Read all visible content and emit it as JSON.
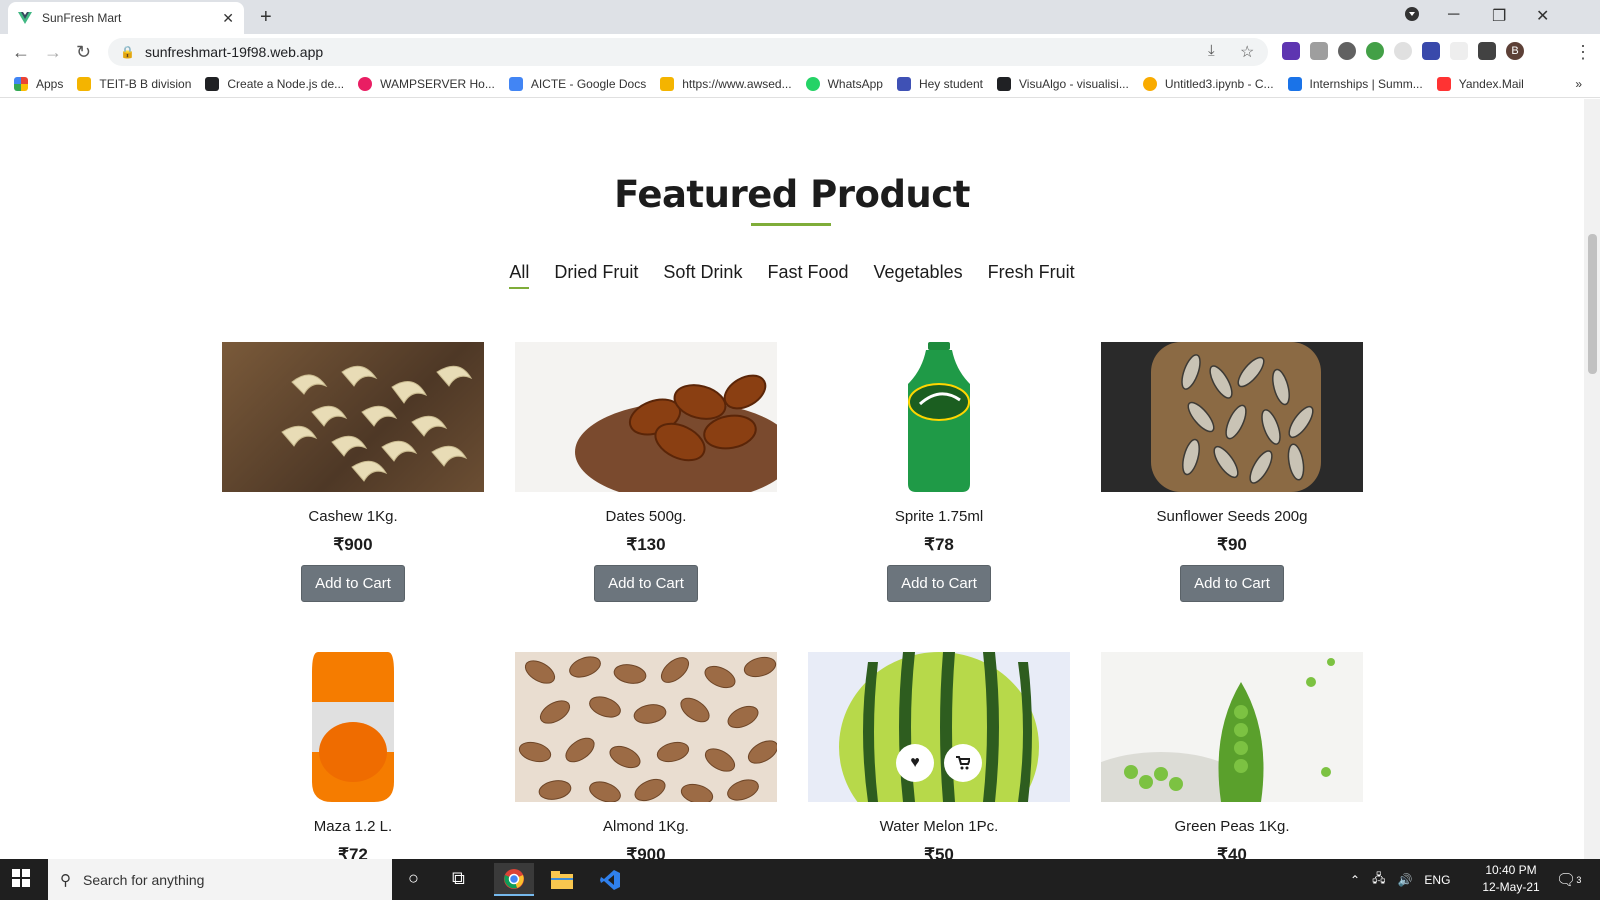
{
  "browser": {
    "tab_title": "SunFresh Mart",
    "url": "sunfreshmart-19f98.web.app",
    "profile_initial": "B"
  },
  "bookmarks": [
    {
      "label": "Apps",
      "color": "#4285f4"
    },
    {
      "label": "TEIT-B B division",
      "color": "#f4b400"
    },
    {
      "label": "Create a Node.js de...",
      "color": "#202124"
    },
    {
      "label": "WAMPSERVER Ho...",
      "color": "#e91e63"
    },
    {
      "label": "AICTE - Google Docs",
      "color": "#4285f4"
    },
    {
      "label": "https://www.awsed...",
      "color": "#f4b400"
    },
    {
      "label": "WhatsApp",
      "color": "#25d366"
    },
    {
      "label": "Hey student",
      "color": "#3f51b5"
    },
    {
      "label": "VisuAlgo - visualisi...",
      "color": "#202124"
    },
    {
      "label": "Untitled3.ipynb - C...",
      "color": "#f9ab00"
    },
    {
      "label": "Internships | Summ...",
      "color": "#1a73e8"
    },
    {
      "label": "Yandex.Mail",
      "color": "#ff3333"
    }
  ],
  "page": {
    "heading": "Featured Product",
    "filters": [
      "All",
      "Dried Fruit",
      "Soft Drink",
      "Fast Food",
      "Vegetables",
      "Fresh Fruit"
    ],
    "add_to_cart_label": "Add to Cart",
    "products": [
      {
        "name": "Cashew 1Kg.",
        "price": "₹900"
      },
      {
        "name": "Dates 500g.",
        "price": "₹130"
      },
      {
        "name": "Sprite 1.75ml",
        "price": "₹78"
      },
      {
        "name": "Sunflower Seeds 200g",
        "price": "₹90"
      },
      {
        "name": "Maza 1.2 L.",
        "price": "₹72"
      },
      {
        "name": "Almond 1Kg.",
        "price": "₹900"
      },
      {
        "name": "Water Melon 1Pc.",
        "price": "₹50"
      },
      {
        "name": "Green Peas 1Kg.",
        "price": "₹40"
      }
    ]
  },
  "taskbar": {
    "search_placeholder": "Search for anything",
    "language": "ENG",
    "time": "10:40 PM",
    "date": "12-May-21",
    "notification_count": "3"
  },
  "colors": {
    "accent": "#7fad39",
    "button": "#6c757d"
  }
}
